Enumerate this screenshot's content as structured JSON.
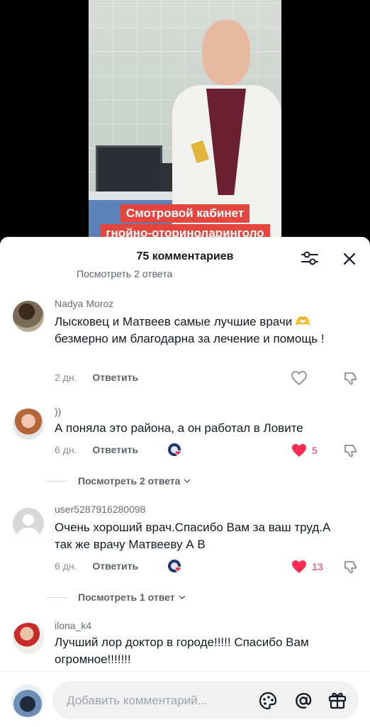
{
  "video": {
    "caption_line1": "Смотровой кабинет",
    "caption_line2": "гнойно-оториноларинголо"
  },
  "sheet": {
    "title": "75 комментариев",
    "cut_reply_text": "Посмотреть 2 ответа"
  },
  "comments": [
    {
      "username": "Nadya Moroz",
      "text": "Лысковец и Матвеев самые лучшие врачи 🫶 безмерно им благодарна за лечение и помощь !",
      "date": "2 дн.",
      "reply_label": "Ответить",
      "like_count": ""
    },
    {
      "username": "))",
      "text": "А поняла это района, а он работал в Ловите",
      "date": "6 дн.",
      "reply_label": "Ответить",
      "like_count": "5",
      "view_replies": "Посмотреть 2 ответа"
    },
    {
      "username": "user5287916280098",
      "text": "Очень хороший врач.Спасибо Вам за ваш труд.А так же врачу Матвееву А В",
      "date": "6 дн.",
      "reply_label": "Ответить",
      "like_count": "13",
      "view_replies": "Посмотреть 1 ответ"
    },
    {
      "username": "ilona_k4",
      "text": "Лучший лор доктор в городе!!!!! Спасибо Вам огромное!!!!!!!"
    }
  ],
  "input": {
    "placeholder": "Добавить комментарий..."
  },
  "colors": {
    "accent_like": "#fe2c55",
    "caption_bg": "#e4463f"
  },
  "icons": [
    "filter-icon",
    "close-icon",
    "heart-icon",
    "dislike-icon",
    "chevron-down-icon",
    "emoji-icon",
    "at-icon",
    "gift-icon"
  ]
}
